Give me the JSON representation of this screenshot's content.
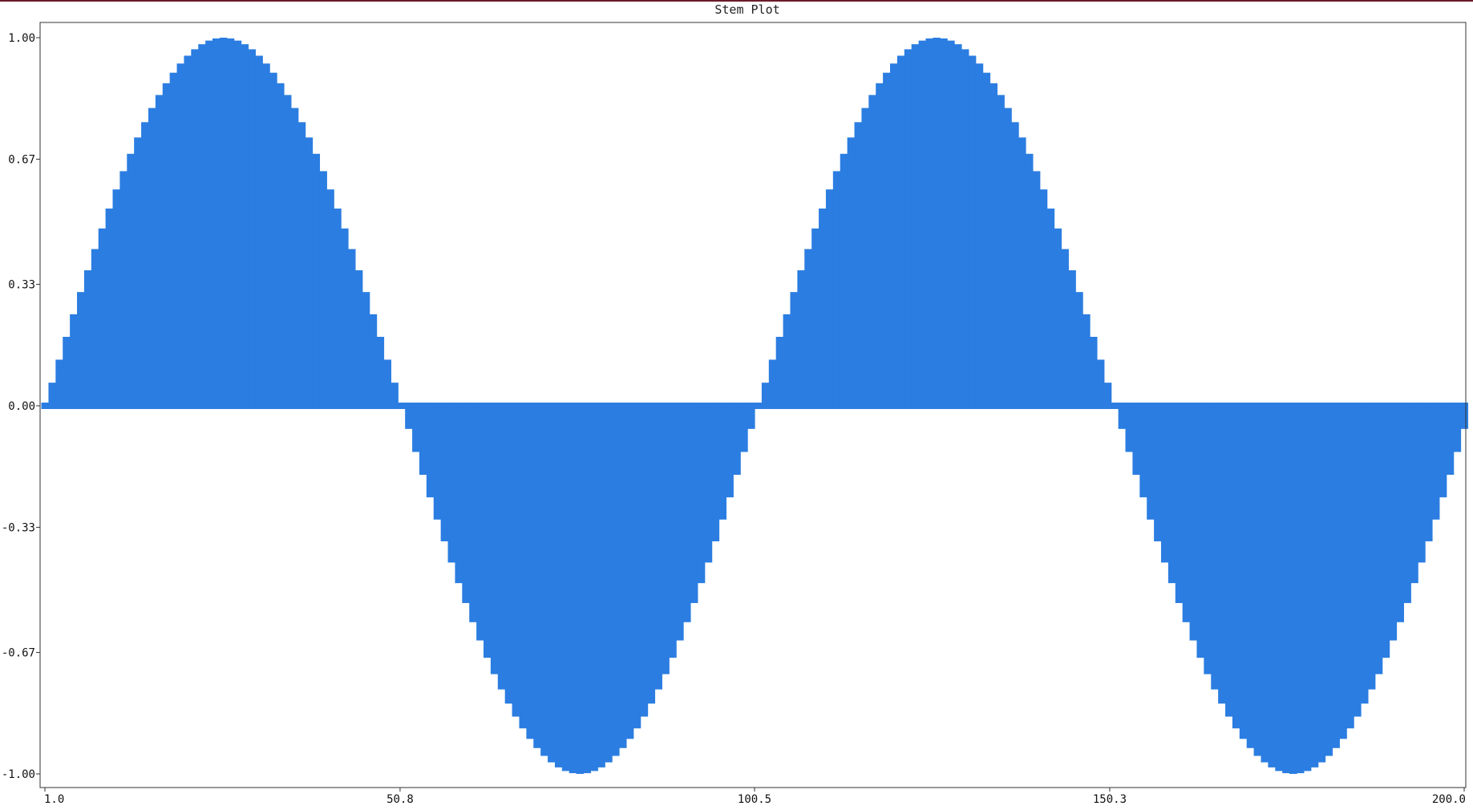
{
  "chart_data": {
    "type": "bar",
    "title": "Stem Plot",
    "xlabel": "",
    "ylabel": "",
    "xlim": [
      1.0,
      200.0
    ],
    "ylim": [
      -1.0,
      1.0
    ],
    "x_ticks": [
      "1.0",
      "50.8",
      "100.5",
      "150.3",
      "200.0"
    ],
    "x_tick_values": [
      1.0,
      50.8,
      100.5,
      150.3,
      200.0
    ],
    "y_ticks": [
      "1.00",
      "0.67",
      "0.33",
      "0.00",
      "-0.33",
      "-0.67",
      "-1.00"
    ],
    "y_tick_values": [
      1.0,
      0.67,
      0.33,
      0.0,
      -0.33,
      -0.67,
      -1.0
    ],
    "x": {
      "start": 1,
      "end": 200,
      "step": 1
    },
    "series": [
      {
        "function": "sin",
        "amplitude": 1.0,
        "period": 100,
        "color": "#2b7de1"
      }
    ],
    "grid": false,
    "legend": "none"
  },
  "colors": {
    "background": "#ffffff",
    "axis": "#333333",
    "bar": "#2b7de1",
    "top_rule": "#6a1a2a"
  }
}
